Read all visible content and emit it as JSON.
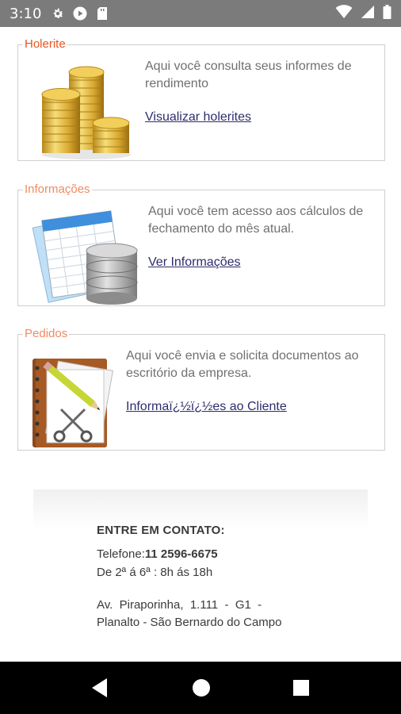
{
  "status_bar": {
    "time": "3:10",
    "icons": [
      "gear-icon",
      "play-protect-icon",
      "sd-card-icon",
      "wifi-icon",
      "signal-icon",
      "battery-icon"
    ]
  },
  "panels": [
    {
      "title": "Holerite",
      "title_color": "#e8541e",
      "description": "Aqui você consulta seus informes de rendimento",
      "link": "Visualizar holerites",
      "icon": "coins-icon"
    },
    {
      "title": "Informações",
      "title_color": "#f08a62",
      "description": "Aqui você tem acesso aos cálculos de fechamento do mês atual.",
      "link": "Ver Informações",
      "icon": "spreadsheet-database-icon"
    },
    {
      "title": "Pedidos",
      "title_color": "#f08a62",
      "description": "Aqui você envia e solicita documentos ao escritório da empresa.",
      "link": "Informaï¿½ï¿½es ao Cliente",
      "icon": "notebook-pencil-scissors-icon"
    }
  ],
  "contact": {
    "title": "ENTRE EM CONTATO:",
    "phone_label": "Telefone:",
    "phone_value": "11 2596-6675",
    "hours": "De 2ª á 6ª : 8h ás 18h",
    "address_line1": "Av.  Piraporinha,  1.111  -  G1  -",
    "address_line2": "Planalto - São Bernardo do Campo"
  },
  "nav": {
    "icons": [
      "back-icon",
      "home-icon",
      "recents-icon"
    ]
  }
}
